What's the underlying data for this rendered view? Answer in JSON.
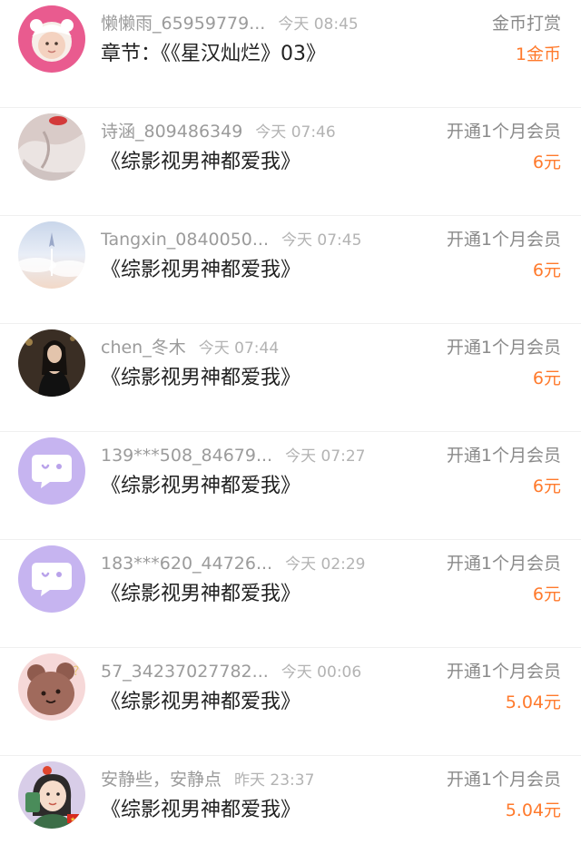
{
  "colors": {
    "name": "#9b9b9b",
    "time": "#b3b3b3",
    "title": "#222222",
    "amount": "#ff7a2c",
    "divider": "#f0f0f0"
  },
  "items": [
    {
      "name": "懒懒雨_65959779...",
      "time": "今天 08:45",
      "title": "章节：《《星汉灿烂》03》",
      "type": "金币打赏",
      "amount": "1金币",
      "avatar": "baby-photo"
    },
    {
      "name": "诗涵_809486349",
      "time": "今天 07:46",
      "title": "《综影视男神都爱我》",
      "type": "开通1个月会员",
      "amount": "6元",
      "avatar": "girl-photo"
    },
    {
      "name": "Tangxin_0840050...",
      "time": "今天 07:45",
      "title": "《综影视男神都爱我》",
      "type": "开通1个月会员",
      "amount": "6元",
      "avatar": "sky-photo"
    },
    {
      "name": "chen_冬木",
      "time": "今天 07:44",
      "title": "《综影视男神都爱我》",
      "type": "开通1个月会员",
      "amount": "6元",
      "avatar": "woman-photo"
    },
    {
      "name": "139***508_84679...",
      "time": "今天 07:27",
      "title": "《综影视男神都爱我》",
      "type": "开通1个月会员",
      "amount": "6元",
      "avatar": "default-chat-icon"
    },
    {
      "name": "183***620_44726...",
      "time": "今天 02:29",
      "title": "《综影视男神都爱我》",
      "type": "开通1个月会员",
      "amount": "6元",
      "avatar": "default-chat-icon"
    },
    {
      "name": "57_34237027782...",
      "time": "今天 00:06",
      "title": "《综影视男神都爱我》",
      "type": "开通1个月会员",
      "amount": "5.04元",
      "avatar": "bear-photo"
    },
    {
      "name": "安静些，安静点",
      "time": "昨天 23:37",
      "title": "《综影视男神都爱我》",
      "type": "开通1个月会员",
      "amount": "5.04元",
      "avatar": "cartoon-photo"
    }
  ]
}
